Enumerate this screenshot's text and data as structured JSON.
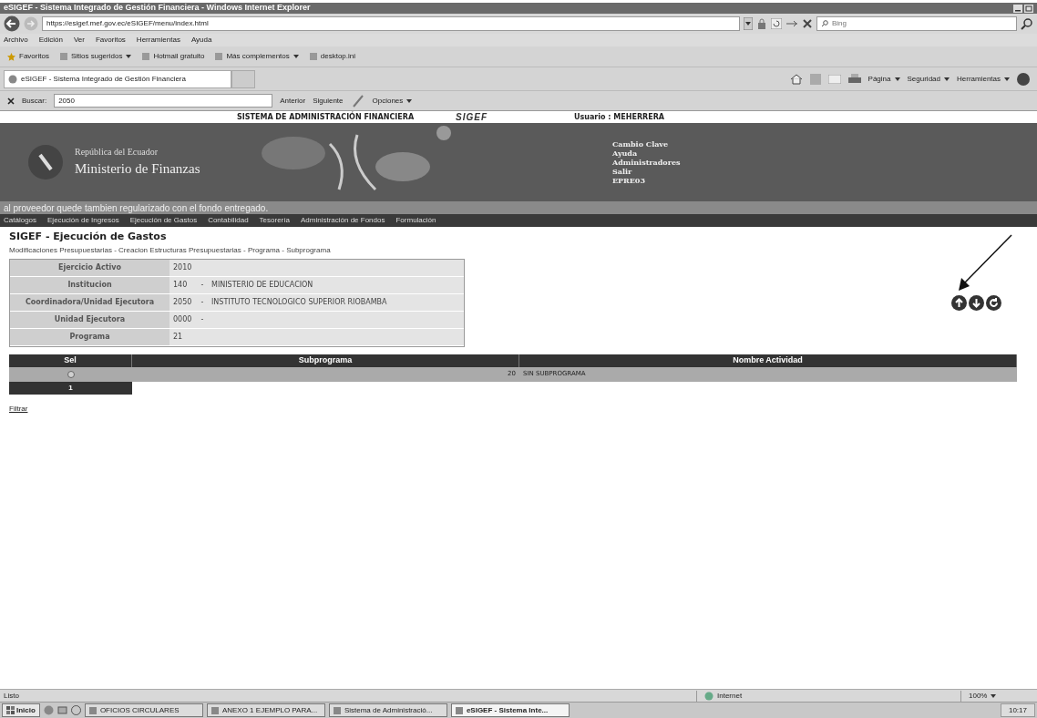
{
  "browser": {
    "title": "eSIGEF - Sistema Integrado de Gestión Financiera - Windows Internet Explorer",
    "address": "https://esigef.mef.gov.ec/eSIGEF/menu/index.html",
    "search_placeholder": "Bing",
    "menu": [
      "Archivo",
      "Edición",
      "Ver",
      "Favoritos",
      "Herramientas",
      "Ayuda"
    ],
    "favorites": {
      "label": "Favoritos",
      "items": [
        {
          "label": "Sitios sugeridos",
          "dropdown": true
        },
        {
          "label": "Hotmail gratuito",
          "dropdown": false
        },
        {
          "label": "Más complementos",
          "dropdown": true
        },
        {
          "label": "desktop.ini",
          "dropdown": false
        }
      ]
    },
    "tab": "eSIGEF - Sistema Integrado de Gestión Financiera",
    "commands": [
      "Página",
      "Seguridad",
      "Herramientas"
    ],
    "find_bar": {
      "label": "Buscar:",
      "value": "2050",
      "buttons": [
        "Anterior",
        "Siguiente"
      ],
      "options": "Opciones"
    }
  },
  "app": {
    "header": {
      "system_title": "SISTEMA DE ADMINISTRACIÓN FINANCIERA",
      "logo": "SIGEF",
      "user": "Usuario : MEHERRERA",
      "country": "República del Ecuador",
      "ministry": "Ministerio de Finanzas",
      "links": [
        "Cambio Clave",
        "Ayuda",
        "Administradores",
        "Salir",
        "EPRE03"
      ]
    },
    "ticker": "al proveedor quede tambien regularizado con el fondo entregado.",
    "nav": [
      "Catálogos",
      "Ejecución de Ingresos",
      "Ejecución de Gastos",
      "Contabilidad",
      "Tesorería",
      "Administración de Fondos",
      "Formulación"
    ],
    "heading": "SIGEF - Ejecución de Gastos",
    "breadcrumb": "Modificaciones Presupuestarias - Creacion Estructuras Presupuestarias - Programa - Subprograma",
    "info": [
      {
        "label": "Ejercicio Activo",
        "code": "2010"
      },
      {
        "label": "Institucion",
        "code": "140",
        "separator": "-",
        "name": "MINISTERIO DE EDUCACION"
      },
      {
        "label": "Coordinadora/Unidad Ejecutora",
        "code": "2050",
        "separator": "-",
        "name": "INSTITUTO TECNOLOGICO SUPERIOR RIOBAMBA"
      },
      {
        "label": "Unidad Ejecutora",
        "code": "0000",
        "separator": "-"
      },
      {
        "label": "Programa",
        "code": "21"
      }
    ],
    "grid": {
      "columns": [
        "Sel",
        "Subprograma",
        "Nombre Actividad"
      ],
      "rows": [
        {
          "selected": false,
          "code": "20",
          "name": "SIN SUBPROGRAMA"
        }
      ],
      "pages": [
        {
          "label": "1",
          "selected": true
        }
      ]
    },
    "filter_link": "Filtrar"
  },
  "status_bar": {
    "text": "Listo",
    "zone": "Internet",
    "zoom": "100%"
  },
  "taskbar": {
    "start": "Inicio",
    "items": [
      {
        "label": "OFICIOS CIRCULARES",
        "selected": false
      },
      {
        "label": "ANEXO 1 EJEMPLO PARA...",
        "selected": false
      },
      {
        "label": "Sistema de Administració...",
        "selected": false
      },
      {
        "label": "eSIGEF - Sistema Inte...",
        "selected": true
      }
    ],
    "clock": "10:17"
  }
}
